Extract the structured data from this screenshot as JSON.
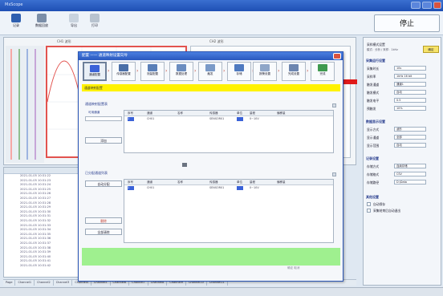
{
  "window": {
    "title": "MxScope"
  },
  "toolbar": {
    "buttons": [
      {
        "label": "记录",
        "icon": "record-icon"
      },
      {
        "label": "数据回放",
        "icon": "playback-icon"
      },
      {
        "label": "导出",
        "icon": "export-icon"
      },
      {
        "label": "打印",
        "icon": "print-icon"
      }
    ],
    "stop_label": "停止"
  },
  "scope": {
    "tab1": "CH1 波形",
    "tab2": "CH2 波形"
  },
  "log": {
    "rows": [
      "2021-01-05 10:31:22",
      "2021-01-05 10:31:23",
      "2021-01-05 10:31:24",
      "2021-01-05 10:31:25",
      "2021-01-05 10:31:26",
      "2021-01-05 10:31:27",
      "2021-01-05 10:31:28",
      "2021-01-05 10:31:29",
      "2021-01-05 10:31:30",
      "2021-01-05 10:31:31",
      "2021-01-05 10:31:32",
      "2021-01-05 10:31:33",
      "2021-01-05 10:31:34",
      "2021-01-05 10:31:35",
      "2021-01-05 10:31:36",
      "2021-01-05 10:31:37",
      "2021-01-05 10:31:38",
      "2021-01-05 10:31:39",
      "2021-01-05 10:31:40",
      "2021-01-05 10:31:41",
      "2021-01-05 10:31:42"
    ]
  },
  "bottom_tabs": [
    "Page",
    "Channel1",
    "Channel2",
    "Channel3",
    "Channel4",
    "Channel5",
    "Channel6",
    "Channel7",
    "Channel8",
    "Channel9",
    "Channel10",
    "Channel11"
  ],
  "right_panel": {
    "header": "采样模式设置",
    "header_sub": "模式：分析 / 采样：1kHz",
    "yellow_btn": "确定",
    "sec1": "采集运行设置",
    "rows1": [
      {
        "label": "采集时长",
        "value": "10s"
      },
      {
        "label": "采样率",
        "value": "1kHz  16 bit"
      },
      {
        "label": "触发通道",
        "value": "通道1"
      },
      {
        "label": "触发模式",
        "value": "自动"
      },
      {
        "label": "触发电平",
        "value": "0.5"
      },
      {
        "label": "预触发",
        "value": "10%"
      }
    ],
    "sec2": "数据显示设置",
    "rows2": [
      {
        "label": "显示方式",
        "value": "波形"
      },
      {
        "label": "显示通道",
        "value": "全部"
      },
      {
        "label": "显示范围",
        "value": "自动"
      }
    ],
    "sec3": "记录设置",
    "rows3": [
      {
        "label": "存储方式",
        "value": "连续存储"
      },
      {
        "label": "存储格式",
        "value": "CSV"
      },
      {
        "label": "存储路径",
        "value": "D:\\Data"
      }
    ],
    "sec4": "其他设置",
    "check1": "自动保存",
    "check2": "采集结束后自动退出"
  },
  "dialog": {
    "title": "配置 —— 通道映射设置向导",
    "steps": [
      {
        "label": "通道配置"
      },
      {
        "label": "传感器配置"
      },
      {
        "label": "测量配置"
      },
      {
        "label": "数据处理"
      },
      {
        "label": "触发"
      },
      {
        "label": "存储"
      },
      {
        "label": "报警设置"
      },
      {
        "label": "完成设置"
      },
      {
        "label": "完成"
      }
    ],
    "banner": "通道映射配置",
    "group1": {
      "label": "通道映射配置表",
      "side_text": "可用通道",
      "button": "添加",
      "headers": [
        "序号",
        "通道",
        "名称",
        "传感器",
        "单位",
        "量程",
        "偏移量"
      ],
      "rows": [
        {
          "c0": "1",
          "c1": "CH01",
          "c2": "",
          "c3": "SENSOR01",
          "c4": "",
          "c5": "0~10V",
          "c6": ""
        }
      ]
    },
    "group2": {
      "label": "已分配通道列表",
      "side_button": "自动分配",
      "remove_button": "删除",
      "clear_button": "全部清除",
      "headers": [
        "序号",
        "通道",
        "名称",
        "传感器",
        "单位",
        "量程",
        "偏移量"
      ],
      "rows": [
        {
          "c0": "1",
          "c1": "CH01",
          "c2": "",
          "c3": "SENSOR01",
          "c4": "",
          "c5": "0~10V",
          "c6": ""
        }
      ]
    },
    "footer": "确定  取消"
  },
  "colors": {
    "accent": "#2a58be",
    "stop_bg": "#fafcff",
    "banner": "#fff200",
    "green_bar": "#9ff08f",
    "marker": "#e01a1a"
  }
}
